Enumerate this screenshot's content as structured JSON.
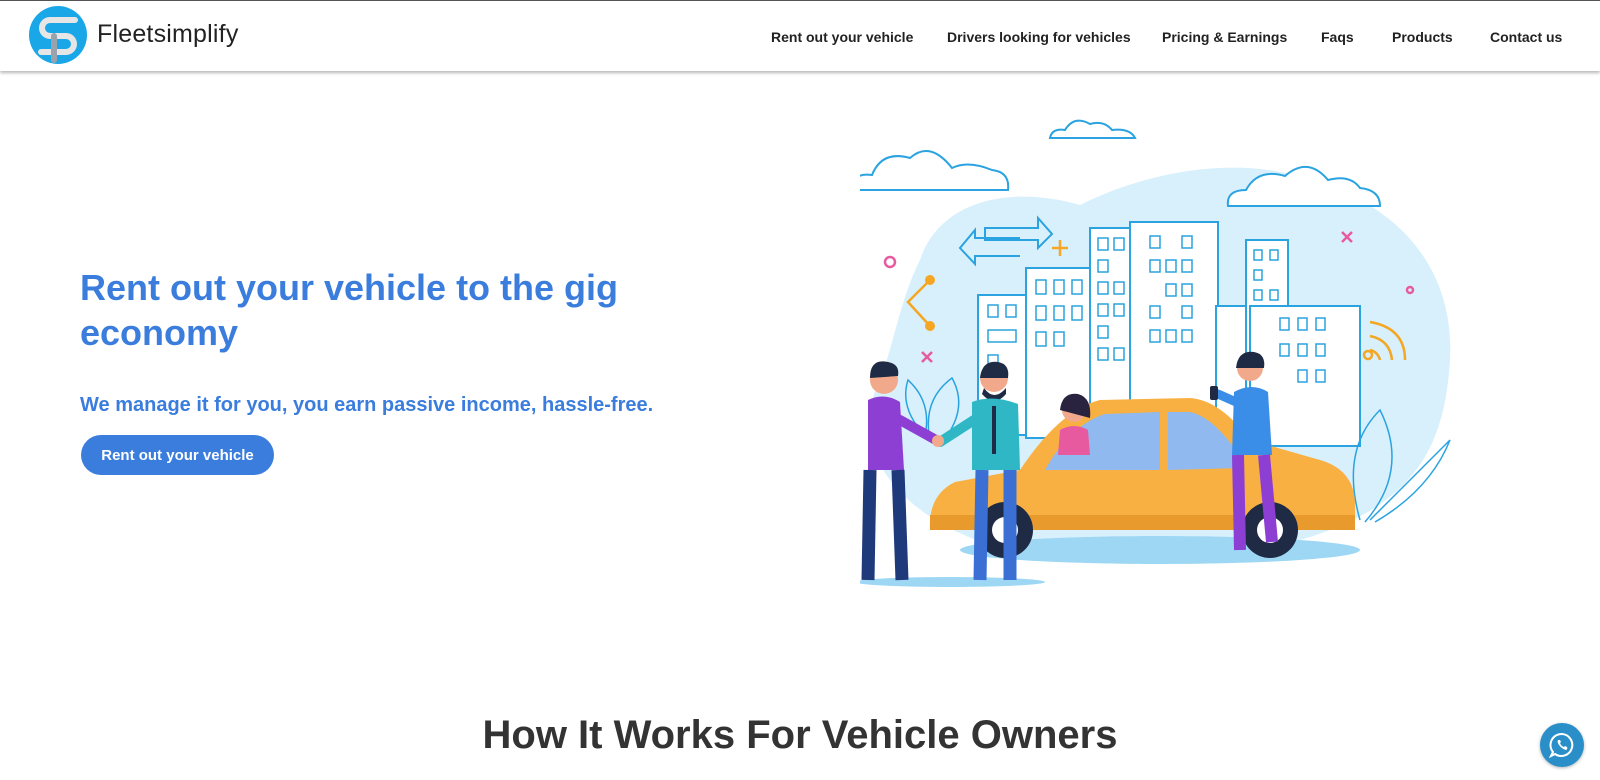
{
  "brand": {
    "name": "Fleetsimplify",
    "logo_icon": "fs-logo-icon"
  },
  "nav": {
    "items": [
      {
        "label": "Rent out your vehicle"
      },
      {
        "label": "Drivers looking for vehicles"
      },
      {
        "label": "Pricing & Earnings"
      },
      {
        "label": "Faqs"
      },
      {
        "label": "Products"
      },
      {
        "label": "Contact us"
      }
    ]
  },
  "hero": {
    "title": "Rent out your vehicle to the gig economy",
    "subtitle": "We manage it for you, you earn passive income, hassle-free.",
    "cta_label": "Rent out your vehicle",
    "illustration": "people-renting-taxi-illustration"
  },
  "section": {
    "title": "How It Works For Vehicle Owners"
  },
  "chat_widget": {
    "icon": "whatsapp-icon"
  },
  "colors": {
    "accent": "#3b7ddd",
    "logo_blue": "#1aa7e8",
    "car_yellow": "#f5a623",
    "chat_bubble": "#2a8fc9"
  }
}
